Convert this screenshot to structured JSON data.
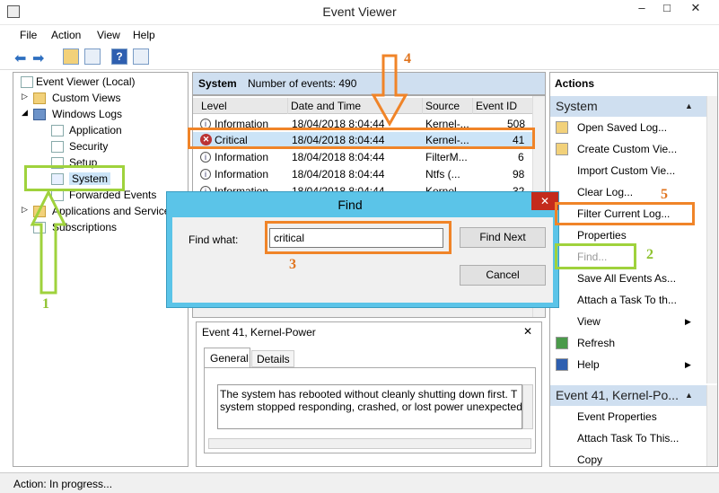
{
  "window": {
    "title": "Event Viewer",
    "min": "–",
    "max": "□",
    "close": "✕"
  },
  "menu": [
    "File",
    "Action",
    "View",
    "Help"
  ],
  "tree": {
    "root": "Event Viewer (Local)",
    "custom_views": "Custom Views",
    "windows_logs": "Windows Logs",
    "application": "Application",
    "security": "Security",
    "setup": "Setup",
    "system": "System",
    "forwarded": "Forwarded Events",
    "apps_services": "Applications and Services",
    "subscriptions": "Subscriptions"
  },
  "log": {
    "name": "System",
    "count_label": "Number of events: 490",
    "columns": [
      "Level",
      "Date and Time",
      "Source",
      "Event ID"
    ],
    "rows": [
      {
        "level": "Information",
        "date": "18/04/2018 8:04:44",
        "source": "Kernel-...",
        "id": "508"
      },
      {
        "level": "Critical",
        "date": "18/04/2018 8:04:44",
        "source": "Kernel-...",
        "id": "41"
      },
      {
        "level": "Information",
        "date": "18/04/2018 8:04:44",
        "source": "FilterM...",
        "id": "6"
      },
      {
        "level": "Information",
        "date": "18/04/2018 8:04:44",
        "source": "Ntfs (...",
        "id": "98"
      },
      {
        "level": "Information",
        "date": "18/04/2018 8:04:44",
        "source": "Kernel-...",
        "id": "32"
      }
    ]
  },
  "find": {
    "title": "Find",
    "label": "Find what:",
    "value": "critical",
    "find_next": "Find Next",
    "cancel": "Cancel",
    "close": "✕"
  },
  "detail": {
    "title": "Event 41, Kernel-Power",
    "tab_general": "General",
    "tab_details": "Details",
    "text1": "The system has rebooted without cleanly shutting down first. T",
    "text2": "system stopped responding, crashed, or lost power unexpected"
  },
  "actions": {
    "header": "Actions",
    "section1": "System",
    "items1": [
      "Open Saved Log...",
      "Create Custom Vie...",
      "Import Custom Vie...",
      "Clear Log...",
      "Filter Current Log...",
      "Properties",
      "Find...",
      "Save All Events As...",
      "Attach a Task To th...",
      "View",
      "Refresh",
      "Help"
    ],
    "section2": "Event 41, Kernel-Po...",
    "items2": [
      "Event Properties",
      "Attach Task To This...",
      "Copy"
    ]
  },
  "status": "Action:  In progress...",
  "annotations": {
    "n1": "1",
    "n2": "2",
    "n3": "3",
    "n4": "4",
    "n5": "5"
  },
  "colors": {
    "orange": "#f08428",
    "green": "#9fd23c",
    "accent": "#cfdff0"
  }
}
